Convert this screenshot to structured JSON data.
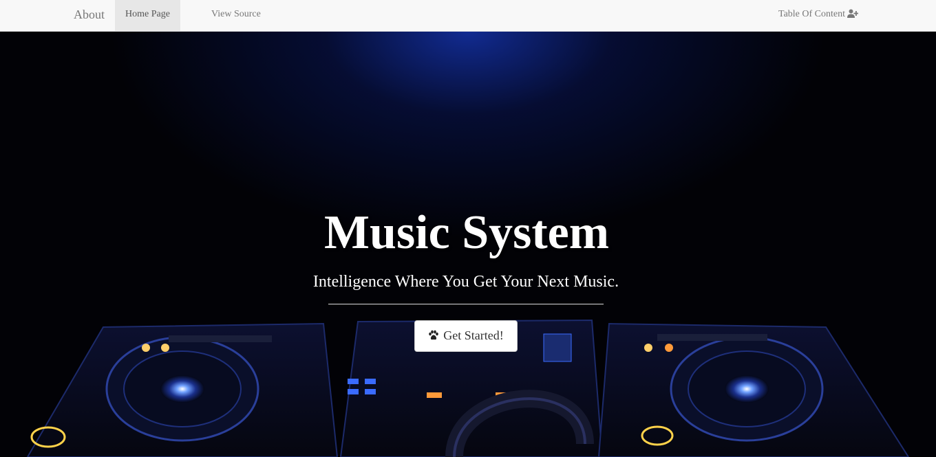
{
  "navbar": {
    "brand": "About",
    "links": [
      {
        "label": "Home Page",
        "active": true
      },
      {
        "label": "View Source",
        "active": false
      }
    ],
    "right_link": {
      "label": "Table Of Content",
      "icon": "user-plus-icon"
    }
  },
  "hero": {
    "title": "Music System",
    "subtitle": "Intelligence Where You Get Your Next Music.",
    "cta": {
      "label": "Get Started!",
      "icon": "paw-icon"
    }
  },
  "colors": {
    "navbar_bg": "#f8f8f8",
    "active_tab_bg": "#e7e7e7",
    "nav_text": "#777777",
    "hero_bg": "#020206",
    "hero_glow": "#1432aa",
    "deck_accent": "#3a6bff",
    "hero_text": "#ffffff"
  }
}
